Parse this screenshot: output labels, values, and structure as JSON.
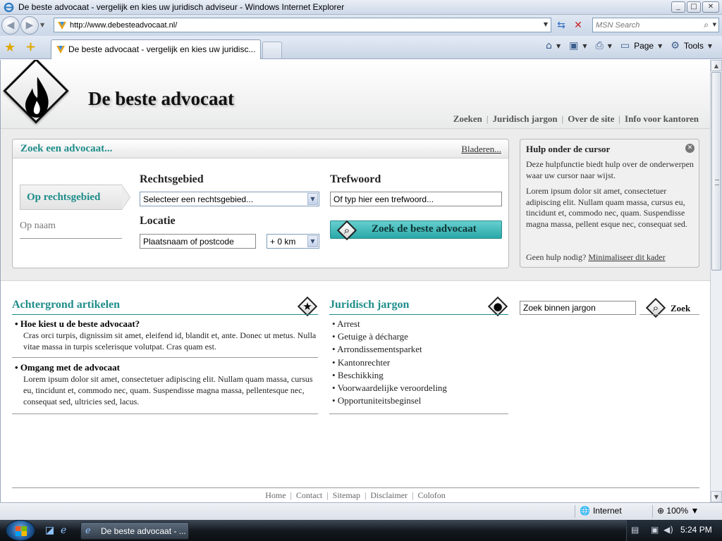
{
  "window": {
    "title": "De beste advocaat - vergelijk en kies uw juridisch adviseur - Windows Internet Explorer",
    "buttons": [
      "_",
      "□",
      "✕"
    ]
  },
  "address": {
    "url": "http://www.debesteadvocaat.nl/",
    "search_placeholder": "MSN Search"
  },
  "tab": {
    "label": "De beste advocaat - vergelijk en kies uw juridisc..."
  },
  "command_bar": {
    "page_label": "Page",
    "tools_label": "Tools"
  },
  "site": {
    "name": "De beste advocaat",
    "nav": [
      "Zoeken",
      "Juridisch jargon",
      "Over de site",
      "Info voor kantoren"
    ]
  },
  "search": {
    "heading": "Zoek een advocaat...",
    "browse_link": "Bladeren...",
    "mode_active": "Op rechtsgebied",
    "mode_other": "Op naam",
    "area_label": "Rechtsgebied",
    "area_value": "Selecteer een rechtsgebied...",
    "keyword_label": "Trefwoord",
    "keyword_value": "Of typ hier een trefwoord...",
    "location_label": "Locatie",
    "location_value": "Plaatsnaam of postcode",
    "radius_value": "+ 0 km",
    "submit_label": "Zoek de beste advocaat"
  },
  "help": {
    "title": "Hulp onder de cursor",
    "intro": "Deze hulpfunctie biedt hulp over de onderwerpen waar uw cursor naar wijst.",
    "body": "Lorem ipsum dolor sit amet, consectetuer adipiscing elit. Nullam quam massa, cursus eu, tincidunt et, commodo nec, quam. Suspendisse magna massa, pellent esque nec, consequat sed.",
    "footer_prefix": "Geen hulp nodig?",
    "footer_link": "Minimaliseer dit kader"
  },
  "articles": {
    "heading": "Achtergrond artikelen",
    "items": [
      {
        "title": "Hoe kiest u de beste advocaat?",
        "body": "Cras orci turpis, dignissim sit amet, eleifend id, blandit et, ante. Donec ut metus. Nulla vitae massa in turpis scelerisque volutpat. Cras quam est."
      },
      {
        "title": "Omgang met de advocaat",
        "body": "Lorem ipsum dolor sit amet, consectetuer adipiscing elit. Nullam quam massa, cursus eu, tincidunt et, commodo nec, quam. Suspendisse magna massa, pellentesque nec, consequat sed, ultricies sed, lacus."
      }
    ]
  },
  "jargon": {
    "heading": "Juridisch jargon",
    "items": [
      "Arrest",
      "Getuige à décharge",
      "Arrondissementsparket",
      "Kantonrechter",
      "Beschikking",
      "Voorwaardelijke veroordeling",
      "Opportuniteitsbeginsel"
    ],
    "search_value": "Zoek binnen jargon",
    "search_button": "Zoek"
  },
  "footer": {
    "links": [
      "Home",
      "Contact",
      "Sitemap",
      "Disclaimer",
      "Colofon"
    ]
  },
  "status": {
    "zone": "Internet",
    "zoom": "100%"
  },
  "taskbar": {
    "item": "De beste advocaat - ...",
    "clock": "5:24 PM"
  },
  "colors": {
    "accent": "#1e8d8a",
    "button": "#2aa8a8"
  }
}
